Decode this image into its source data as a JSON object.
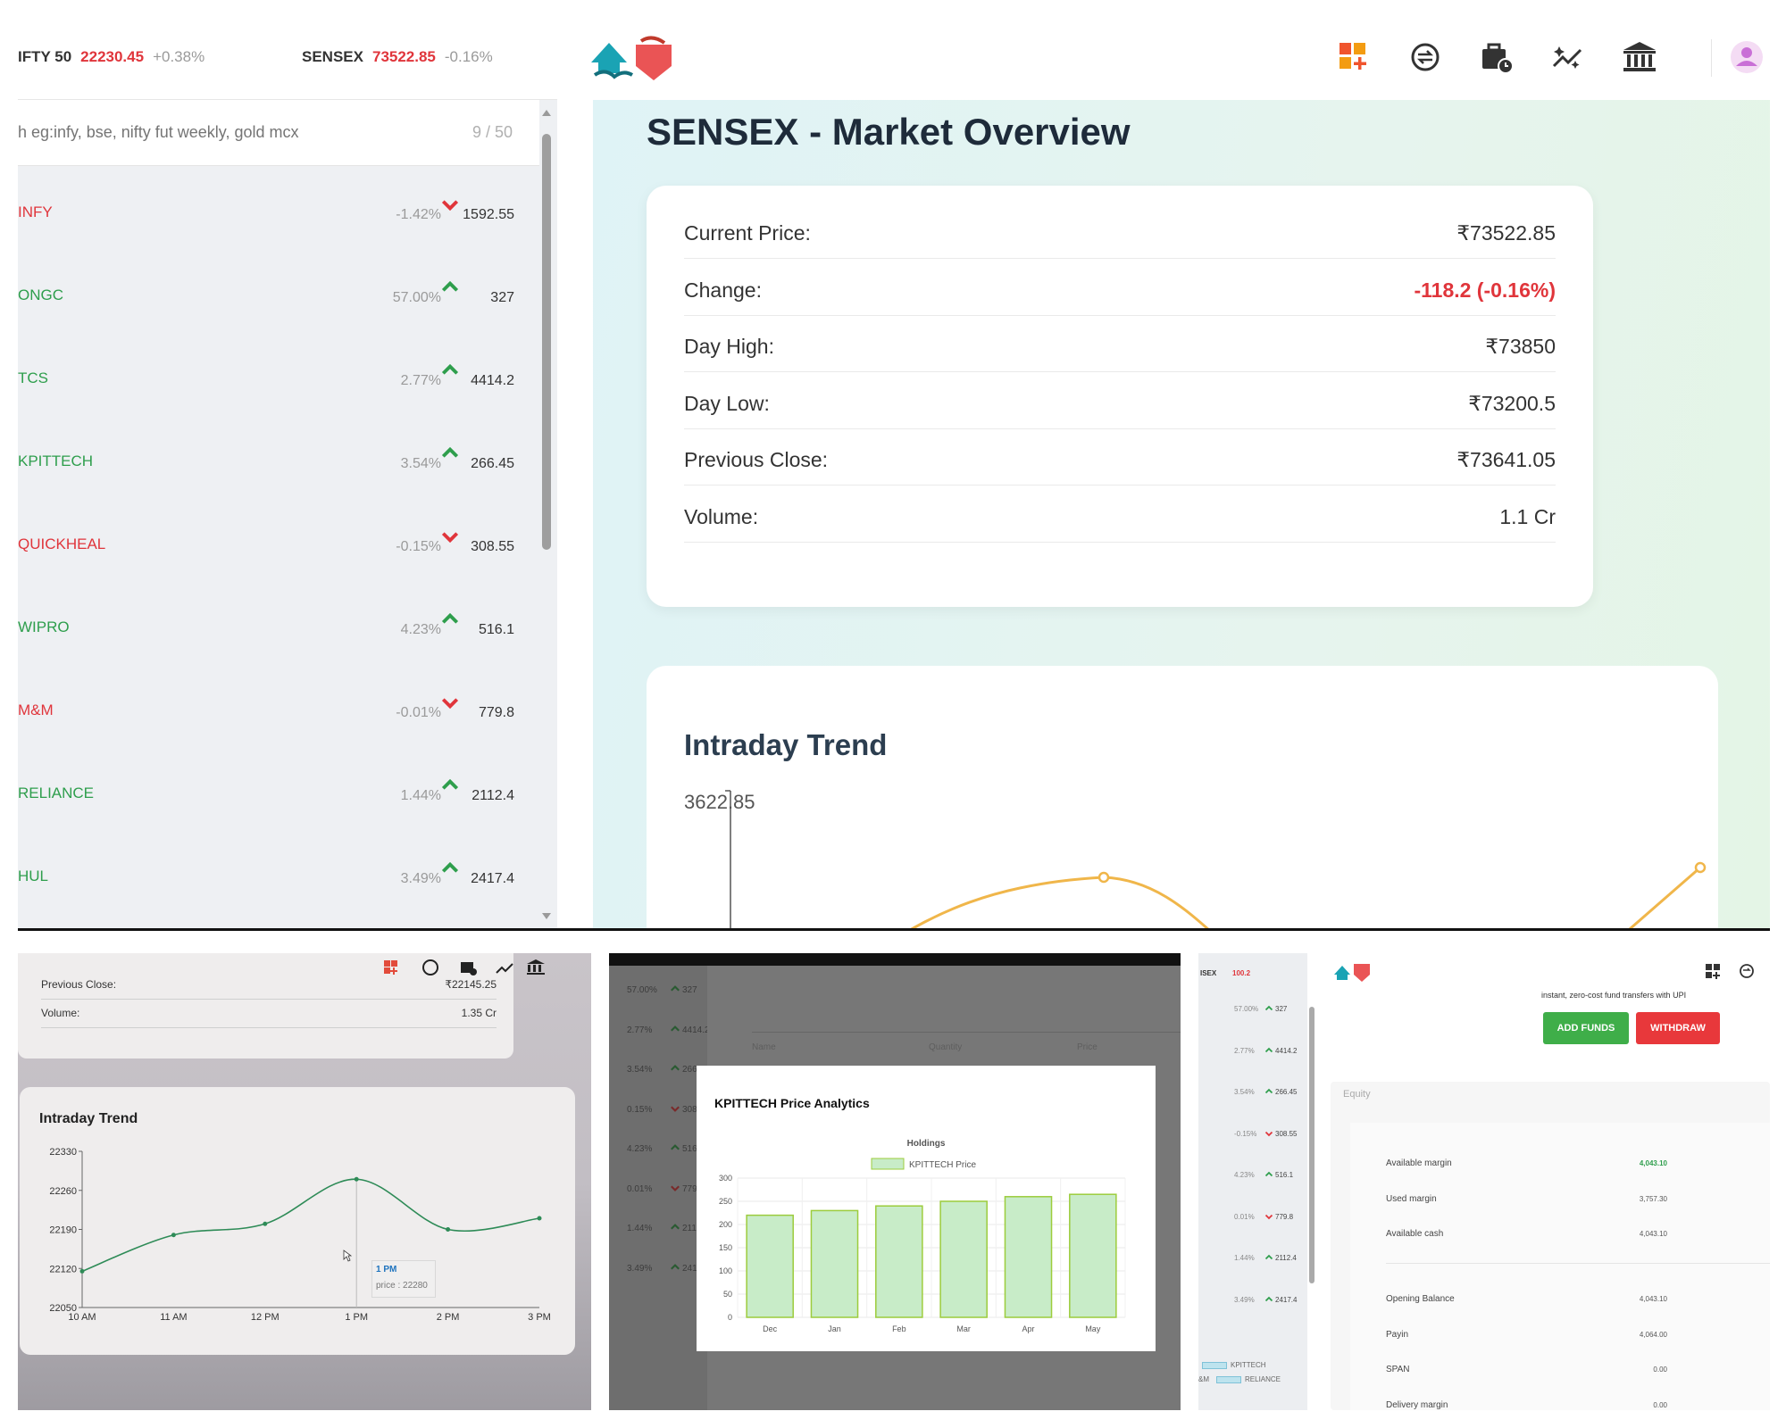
{
  "ticker": {
    "nifty": {
      "name": "IFTY 50",
      "price": "22230.45",
      "change": "+0.38%"
    },
    "sensex": {
      "name": "SENSEX",
      "price": "73522.85",
      "change": "-0.16%"
    }
  },
  "search": {
    "placeholder": "h eg:infy, bse, nifty fut weekly, gold mcx",
    "count": "9 / 50"
  },
  "watchlist": [
    {
      "symbol": "INFY",
      "change": "-1.42%",
      "direction": "down",
      "ltp": "1592.55"
    },
    {
      "symbol": "ONGC",
      "change": "57.00%",
      "direction": "up",
      "ltp": "327"
    },
    {
      "symbol": "TCS",
      "change": "2.77%",
      "direction": "up",
      "ltp": "4414.2"
    },
    {
      "symbol": "KPITTECH",
      "change": "3.54%",
      "direction": "up",
      "ltp": "266.45"
    },
    {
      "symbol": "QUICKHEAL",
      "change": "-0.15%",
      "direction": "down",
      "ltp": "308.55"
    },
    {
      "symbol": "WIPRO",
      "change": "4.23%",
      "direction": "up",
      "ltp": "516.1"
    },
    {
      "symbol": "M&M",
      "change": "-0.01%",
      "direction": "down",
      "ltp": "779.8"
    },
    {
      "symbol": "RELIANCE",
      "change": "1.44%",
      "direction": "up",
      "ltp": "2112.4"
    },
    {
      "symbol": "HUL",
      "change": "3.49%",
      "direction": "up",
      "ltp": "2417.4"
    }
  ],
  "header_icons": [
    "dashboard-add-icon",
    "exchange-icon",
    "portfolio-icon",
    "analytics-icon",
    "bank-icon",
    "profile-icon"
  ],
  "overview": {
    "title": "SENSEX - Market Overview",
    "rows": [
      {
        "label": "Current Price:",
        "value": "₹73522.85"
      },
      {
        "label": "Change:",
        "value": "-118.2 (-0.16%)"
      },
      {
        "label": "Day High:",
        "value": "₹73850"
      },
      {
        "label": "Day Low:",
        "value": "₹73200.5"
      },
      {
        "label": "Previous Close:",
        "value": "₹73641.05"
      },
      {
        "label": "Volume:",
        "value": "1.1 Cr"
      }
    ]
  },
  "trend": {
    "title": "Intraday Trend",
    "ymax_label": "3622.85"
  },
  "colors": {
    "up": "#2e9e4c",
    "down": "#e0353b",
    "accent": "#f39c12",
    "chart_line": "#2e8b57",
    "bar_fill": "#c8ecc8",
    "bar_stroke": "#9ccc3c"
  },
  "panel1": {
    "rows": [
      {
        "label": "Previous Close:",
        "value": "₹22145.25"
      },
      {
        "label": "Volume:",
        "value": "1.35 Cr"
      }
    ],
    "chart_title": "Intraday Trend",
    "tooltip": {
      "label": "1 PM",
      "text": "price : 22280"
    }
  },
  "panel2": {
    "modal_title": "KPITTECH Price Analytics",
    "table_headers": [
      "Name",
      "Quantity",
      "Price"
    ],
    "side_rows": [
      {
        "change": "57.00%",
        "ltp": "327",
        "direction": "up"
      },
      {
        "change": "2.77%",
        "ltp": "4414.2",
        "direction": "up"
      },
      {
        "change": "3.54%",
        "ltp": "266.45",
        "direction": "up"
      },
      {
        "change": "0.15%",
        "ltp": "308.55",
        "direction": "down"
      },
      {
        "change": "4.23%",
        "ltp": "516.1",
        "direction": "up"
      },
      {
        "change": "0.01%",
        "ltp": "779.8",
        "direction": "down"
      },
      {
        "change": "1.44%",
        "ltp": "2112.4",
        "direction": "up"
      },
      {
        "change": "3.49%",
        "ltp": "2417.4",
        "direction": "up"
      }
    ]
  },
  "panel3": {
    "ticker": {
      "name": "ISEX",
      "value": "100.2"
    },
    "upi_text": "instant, zero-cost fund transfers with UPI",
    "add_funds": "ADD FUNDS",
    "withdraw": "WITHDRAW",
    "section": "Equity",
    "margin_rows": [
      {
        "label": "Available margin",
        "value": "4,043.10"
      },
      {
        "label": "Used margin",
        "value": "3,757.30"
      },
      {
        "label": "Available cash",
        "value": "4,043.10"
      },
      {
        "label": "Opening Balance",
        "value": "4,043.10"
      },
      {
        "label": "Payin",
        "value": "4,064.00"
      },
      {
        "label": "SPAN",
        "value": "0.00"
      },
      {
        "label": "Delivery margin",
        "value": "0.00"
      }
    ],
    "side_rows": [
      {
        "change": "57.00%",
        "ltp": "327",
        "direction": "up"
      },
      {
        "change": "2.77%",
        "ltp": "4414.2",
        "direction": "up"
      },
      {
        "change": "3.54%",
        "ltp": "266.45",
        "direction": "up"
      },
      {
        "change": "-0.15%",
        "ltp": "308.55",
        "direction": "down"
      },
      {
        "change": "4.23%",
        "ltp": "516.1",
        "direction": "up"
      },
      {
        "change": "0.01%",
        "ltp": "779.8",
        "direction": "down"
      },
      {
        "change": "1.44%",
        "ltp": "2112.4",
        "direction": "up"
      },
      {
        "change": "3.49%",
        "ltp": "2417.4",
        "direction": "up"
      }
    ],
    "legend": [
      "KPITTECH",
      "RELIANCE"
    ],
    "legend_prefix": "&M"
  },
  "chart_data": [
    {
      "type": "line",
      "title": "Intraday Trend",
      "x": [
        "10 AM",
        "11 AM",
        "12 PM",
        "1 PM",
        "2 PM",
        "3 PM"
      ],
      "values": [
        22115,
        22180,
        22200,
        22280,
        22190,
        22210
      ],
      "yticks": [
        22050,
        22120,
        22190,
        22260,
        22330
      ],
      "ylim": [
        22050,
        22330
      ],
      "grid": false,
      "legend": "none"
    },
    {
      "type": "bar",
      "title": "Holdings",
      "categories": [
        "Dec",
        "Jan",
        "Feb",
        "Mar",
        "Apr",
        "May"
      ],
      "series": [
        {
          "name": "KPITTECH Price",
          "values": [
            220,
            230,
            240,
            250,
            260,
            265
          ]
        }
      ],
      "yticks": [
        0,
        50,
        100,
        150,
        200,
        250,
        300
      ],
      "ylim": [
        0,
        300
      ],
      "grid": true,
      "legend": "top-center"
    }
  ]
}
